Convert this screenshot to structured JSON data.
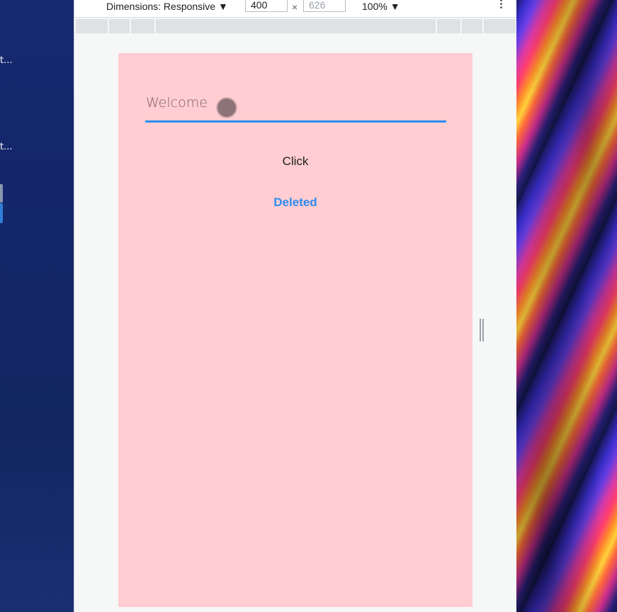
{
  "desktop": {
    "labels": [
      "t...",
      "t..."
    ]
  },
  "devtools": {
    "dimensions_label": "Dimensions: Responsive ▼",
    "width_value": "400",
    "height_value": "626",
    "times_symbol": "×",
    "zoom_label": "100% ▼"
  },
  "app": {
    "text_field_value": "Welcome",
    "click_button_label": "Click",
    "deleted_label": "Deleted"
  },
  "colors": {
    "viewport_background": "#ffcdd2",
    "accent": "#2f8cf0"
  }
}
